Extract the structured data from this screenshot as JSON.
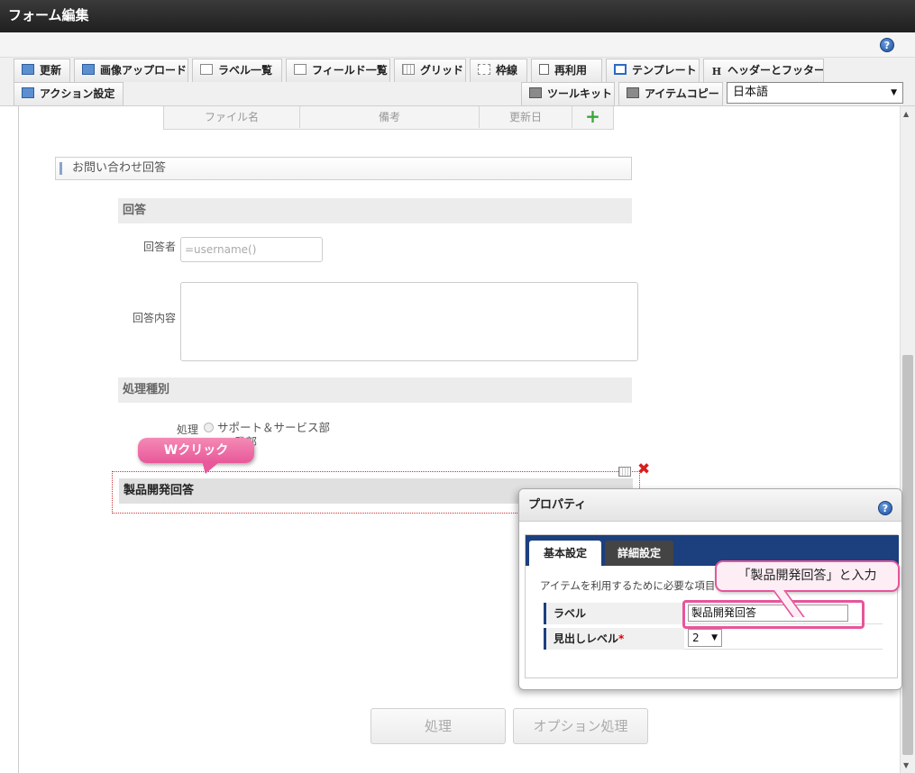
{
  "window": {
    "title": "フォーム編集"
  },
  "toolbar": {
    "row1": [
      {
        "label": "更新",
        "icon": "pencil-icon"
      },
      {
        "label": "画像アップロード",
        "icon": "image-upload-icon"
      },
      {
        "label": "ラベル一覧",
        "icon": "label-list-icon"
      },
      {
        "label": "フィールド一覧",
        "icon": "field-list-icon"
      },
      {
        "label": "グリッド",
        "icon": "grid-icon"
      },
      {
        "label": "枠線",
        "icon": "border-icon"
      },
      {
        "label": "再利用",
        "icon": "reuse-icon"
      },
      {
        "label": "テンプレート",
        "icon": "template-icon"
      },
      {
        "label": "ヘッダーとフッター",
        "icon": "header-footer-icon",
        "glyph": "H"
      }
    ],
    "row2": [
      {
        "label": "アクション設定",
        "icon": "action-icon"
      },
      {
        "label": "ツールキット",
        "icon": "toolkit-icon"
      },
      {
        "label": "アイテムコピー",
        "icon": "item-copy-icon"
      }
    ],
    "language": "日本語"
  },
  "file_table": {
    "headers": [
      "ファイル名",
      "備考",
      "更新日"
    ]
  },
  "form": {
    "section_title": "お問い合わせ回答",
    "answer_header": "回答",
    "respondent_label": "回答者",
    "respondent_placeholder": "=username()",
    "answer_content_label": "回答内容",
    "processing_type_header": "処理種別",
    "processing_label": "処理",
    "radio_option1": "サポート＆サービス部",
    "radio_option2_partial": "発部",
    "selected_item_label": "製品開発回答"
  },
  "annotations": {
    "double_click": "Wクリック",
    "input_hint": "「製品開発回答」と入力"
  },
  "properties": {
    "title": "プロパティ",
    "tabs": [
      "基本設定",
      "詳細設定"
    ],
    "description": "アイテムを利用するために必要な項目",
    "label_field": "ラベル",
    "label_value": "製品開発回答",
    "heading_level_field": "見出しレベル",
    "required_mark": "*",
    "heading_level_value": "2"
  },
  "buttons": {
    "process": "処理",
    "option_process": "オプション処理"
  },
  "colors": {
    "accent_pink": "#e6559a",
    "tab_navy": "#1c3f7e",
    "delete_red": "#d81e1e"
  }
}
